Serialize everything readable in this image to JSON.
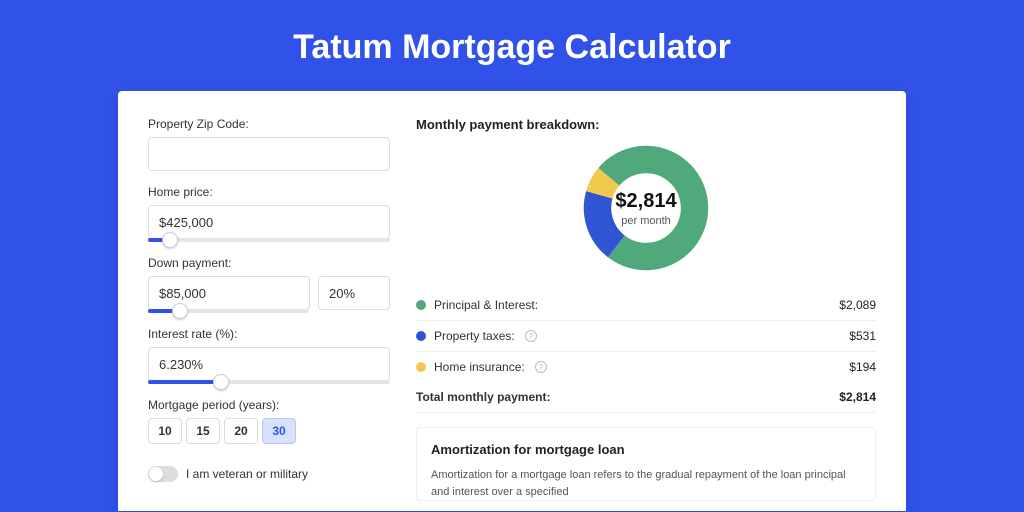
{
  "page": {
    "title": "Tatum Mortgage Calculator"
  },
  "form": {
    "zip": {
      "label": "Property Zip Code:",
      "value": ""
    },
    "home_price": {
      "label": "Home price:",
      "value": "$425,000",
      "slider_pct": 9
    },
    "down_payment": {
      "label": "Down payment:",
      "value": "$85,000",
      "pct_value": "20%",
      "slider_pct": 20
    },
    "interest_rate": {
      "label": "Interest rate (%):",
      "value": "6.230%",
      "slider_pct": 30
    },
    "period": {
      "label": "Mortgage period (years):",
      "options": [
        "10",
        "15",
        "20",
        "30"
      ],
      "active": "30"
    },
    "veteran": {
      "label": "I am veteran or military",
      "on": false
    }
  },
  "breakdown": {
    "title": "Monthly payment breakdown:",
    "center_amount": "$2,814",
    "center_sub": "per month",
    "rows": [
      {
        "label": "Principal & Interest:",
        "value": "$2,089",
        "color": "#4fa97a",
        "info": false
      },
      {
        "label": "Property taxes:",
        "value": "$531",
        "color": "#2f55d4",
        "info": true
      },
      {
        "label": "Home insurance:",
        "value": "$194",
        "color": "#f2c94c",
        "info": true
      }
    ],
    "total": {
      "label": "Total monthly payment:",
      "value": "$2,814"
    }
  },
  "chart_data": {
    "type": "pie",
    "title": "Monthly payment breakdown",
    "series": [
      {
        "name": "Principal & Interest",
        "value": 2089,
        "color": "#4fa97a"
      },
      {
        "name": "Property taxes",
        "value": 531,
        "color": "#2f55d4"
      },
      {
        "name": "Home insurance",
        "value": 194,
        "color": "#f2c94c"
      }
    ],
    "total": 2814,
    "center_label": "$2,814 per month"
  },
  "amortization": {
    "title": "Amortization for mortgage loan",
    "text": "Amortization for a mortgage loan refers to the gradual repayment of the loan principal and interest over a specified"
  }
}
